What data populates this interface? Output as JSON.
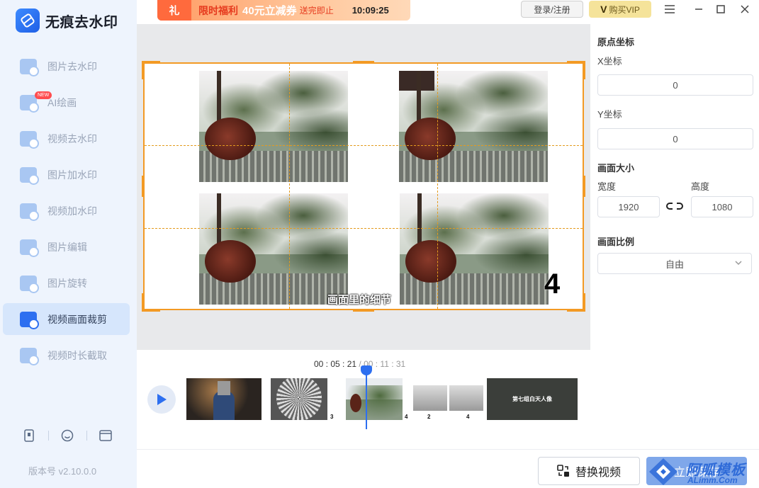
{
  "app": {
    "name": "无痕去水印"
  },
  "promo": {
    "gift_label": "礼",
    "label": "限时福利",
    "offer": "40元立减券",
    "note": "送完即止",
    "countdown": "10:09:25"
  },
  "header": {
    "login_label": "登录/注册",
    "vip_v": "V",
    "vip_label": "购买VIP"
  },
  "sidebar": {
    "items": [
      {
        "label": "图片去水印"
      },
      {
        "label": "AI绘画",
        "badge": "NEW"
      },
      {
        "label": "视频去水印"
      },
      {
        "label": "图片加水印"
      },
      {
        "label": "视频加水印"
      },
      {
        "label": "图片编辑"
      },
      {
        "label": "图片旋转"
      },
      {
        "label": "视频画面裁剪",
        "active": true
      },
      {
        "label": "视频时长截取"
      }
    ],
    "version": "版本号 v2.10.0.0"
  },
  "preview": {
    "subtitle": "画面里的细节",
    "number": "4"
  },
  "timeline": {
    "current": "00 : 05 : 21",
    "separator": " / ",
    "total": "00 : 11 : 31",
    "clip_numbers": [
      "3",
      "4",
      "2",
      "4"
    ],
    "title_card": "第七组白天人像",
    "playhead_fraction": 0.46
  },
  "panel": {
    "origin_title": "原点坐标",
    "x_label": "X坐标",
    "x_value": "0",
    "y_label": "Y坐标",
    "y_value": "0",
    "size_title": "画面大小",
    "width_label": "宽度",
    "width_value": "1920",
    "height_label": "高度",
    "height_value": "1080",
    "ratio_title": "画面比例",
    "ratio_value": "自由"
  },
  "bottom": {
    "replace_label": "替换视频",
    "save_label": "立即保存"
  },
  "watermark": {
    "text": "阿呱模板",
    "sub": "ALimm.Com"
  },
  "colors": {
    "accent": "#2d6ff0",
    "crop": "#f39a24",
    "sidebar_bg": "#eef4fd"
  }
}
